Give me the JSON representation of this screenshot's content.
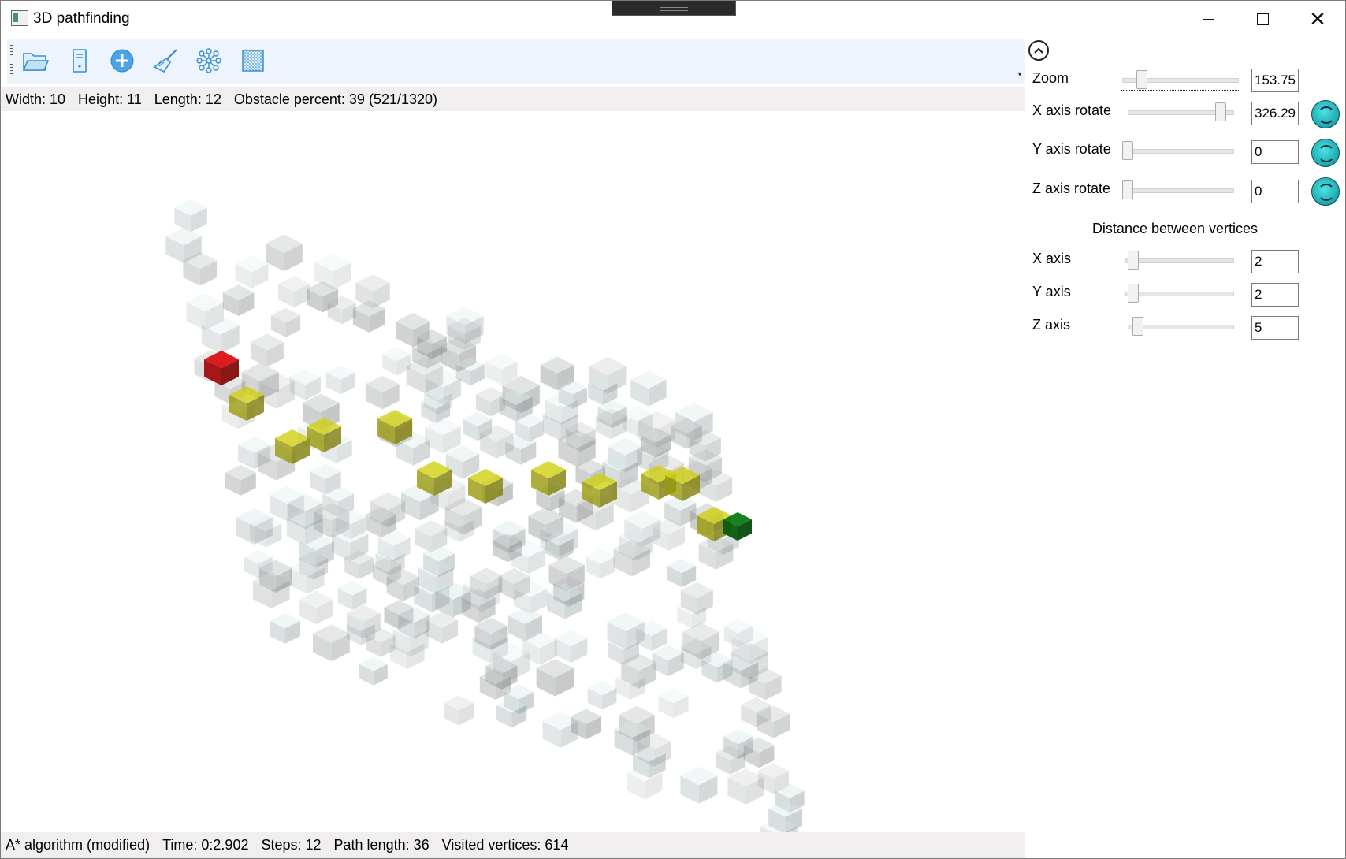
{
  "window": {
    "title": "3D pathfinding"
  },
  "toolbar": {
    "items": [
      {
        "icon": "folder-open-icon"
      },
      {
        "icon": "server-icon"
      },
      {
        "icon": "add-circle-icon"
      },
      {
        "icon": "broom-icon"
      },
      {
        "icon": "graph-nodes-icon"
      },
      {
        "icon": "grid-texture-icon"
      }
    ]
  },
  "info": {
    "width": "Width: 10",
    "height": "Height: 11",
    "length": "Length: 12",
    "obstacle": "Obstacle percent: 39 (521/1320)"
  },
  "status": {
    "algorithm": "A* algorithm (modified)",
    "time": "Time: 0:2.902",
    "steps": "Steps: 12",
    "path_length": "Path length: 36",
    "visited": "Visited vertices: 614"
  },
  "panel": {
    "zoom": {
      "label": "Zoom",
      "value": "153.75",
      "fraction": 0.13
    },
    "x_rotate": {
      "label": "X axis rotate",
      "value": "326.29",
      "fraction": 0.906
    },
    "y_rotate": {
      "label": "Y axis rotate",
      "value": "0",
      "fraction": 0
    },
    "z_rotate": {
      "label": "Z axis rotate",
      "value": "0",
      "fraction": 0
    },
    "distance_title": "Distance between vertices",
    "x_axis": {
      "label": "X axis",
      "value": "2",
      "fraction": 0.02
    },
    "y_axis": {
      "label": "Y axis",
      "value": "2",
      "fraction": 0.02
    },
    "z_axis": {
      "label": "Z axis",
      "value": "5",
      "fraction": 0.05
    }
  },
  "colors": {
    "start": "#c01010",
    "end": "#0a6b10",
    "path": "#b5b510",
    "obstacle": "#b9c9c9",
    "accent": "#1aa7b0"
  }
}
